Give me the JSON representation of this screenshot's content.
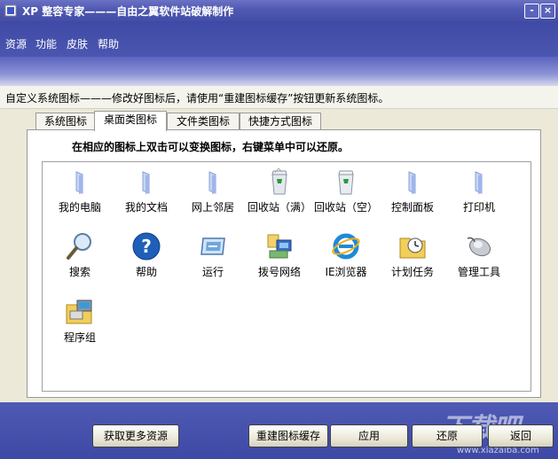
{
  "window": {
    "title": "XP 整容专家———自由之翼软件站破解制作",
    "minimize_label": "-",
    "close_label": "×"
  },
  "menu": [
    {
      "label": "资源"
    },
    {
      "label": "功能"
    },
    {
      "label": "皮肤"
    },
    {
      "label": "帮助"
    }
  ],
  "info_text": "自定义系统图标———修改好图标后，请使用“重建图标缓存”按钮更新系统图标。",
  "tabs": [
    {
      "label": "系统图标",
      "active": false
    },
    {
      "label": "桌面类图标",
      "active": true
    },
    {
      "label": "文件类图标",
      "active": false
    },
    {
      "label": "快捷方式图标",
      "active": false
    }
  ],
  "hint": "在相应的图标上双击可以变换图标，右键菜单中可以还原。",
  "icons": [
    {
      "label": "我的电脑",
      "icon": "folder-icon"
    },
    {
      "label": "我的文档",
      "icon": "folder-icon"
    },
    {
      "label": "网上邻居",
      "icon": "folder-icon"
    },
    {
      "label": "回收站（满）",
      "icon": "recycle-bin-full-icon"
    },
    {
      "label": "回收站（空）",
      "icon": "recycle-bin-empty-icon"
    },
    {
      "label": "控制面板",
      "icon": "folder-icon"
    },
    {
      "label": "打印机",
      "icon": "folder-icon"
    },
    {
      "label": "搜索",
      "icon": "search-icon"
    },
    {
      "label": "帮助",
      "icon": "help-icon"
    },
    {
      "label": "运行",
      "icon": "run-icon"
    },
    {
      "label": "拨号网络",
      "icon": "dialup-network-icon"
    },
    {
      "label": "IE浏览器",
      "icon": "ie-browser-icon"
    },
    {
      "label": "计划任务",
      "icon": "scheduled-tasks-icon"
    },
    {
      "label": "管理工具",
      "icon": "admin-tools-icon"
    },
    {
      "label": "程序组",
      "icon": "program-group-icon"
    }
  ],
  "buttons": {
    "get_more": "获取更多资源",
    "rebuild_cache": "重建图标缓存",
    "apply": "应用",
    "restore": "还原",
    "back": "返回"
  },
  "watermark": {
    "text": "下载吧",
    "url": "www.xiazaiba.com"
  },
  "colors": {
    "title_bar": "#4f58b2",
    "menu_bar": "#3f4aa6",
    "content_bg": "#ece9d8"
  }
}
